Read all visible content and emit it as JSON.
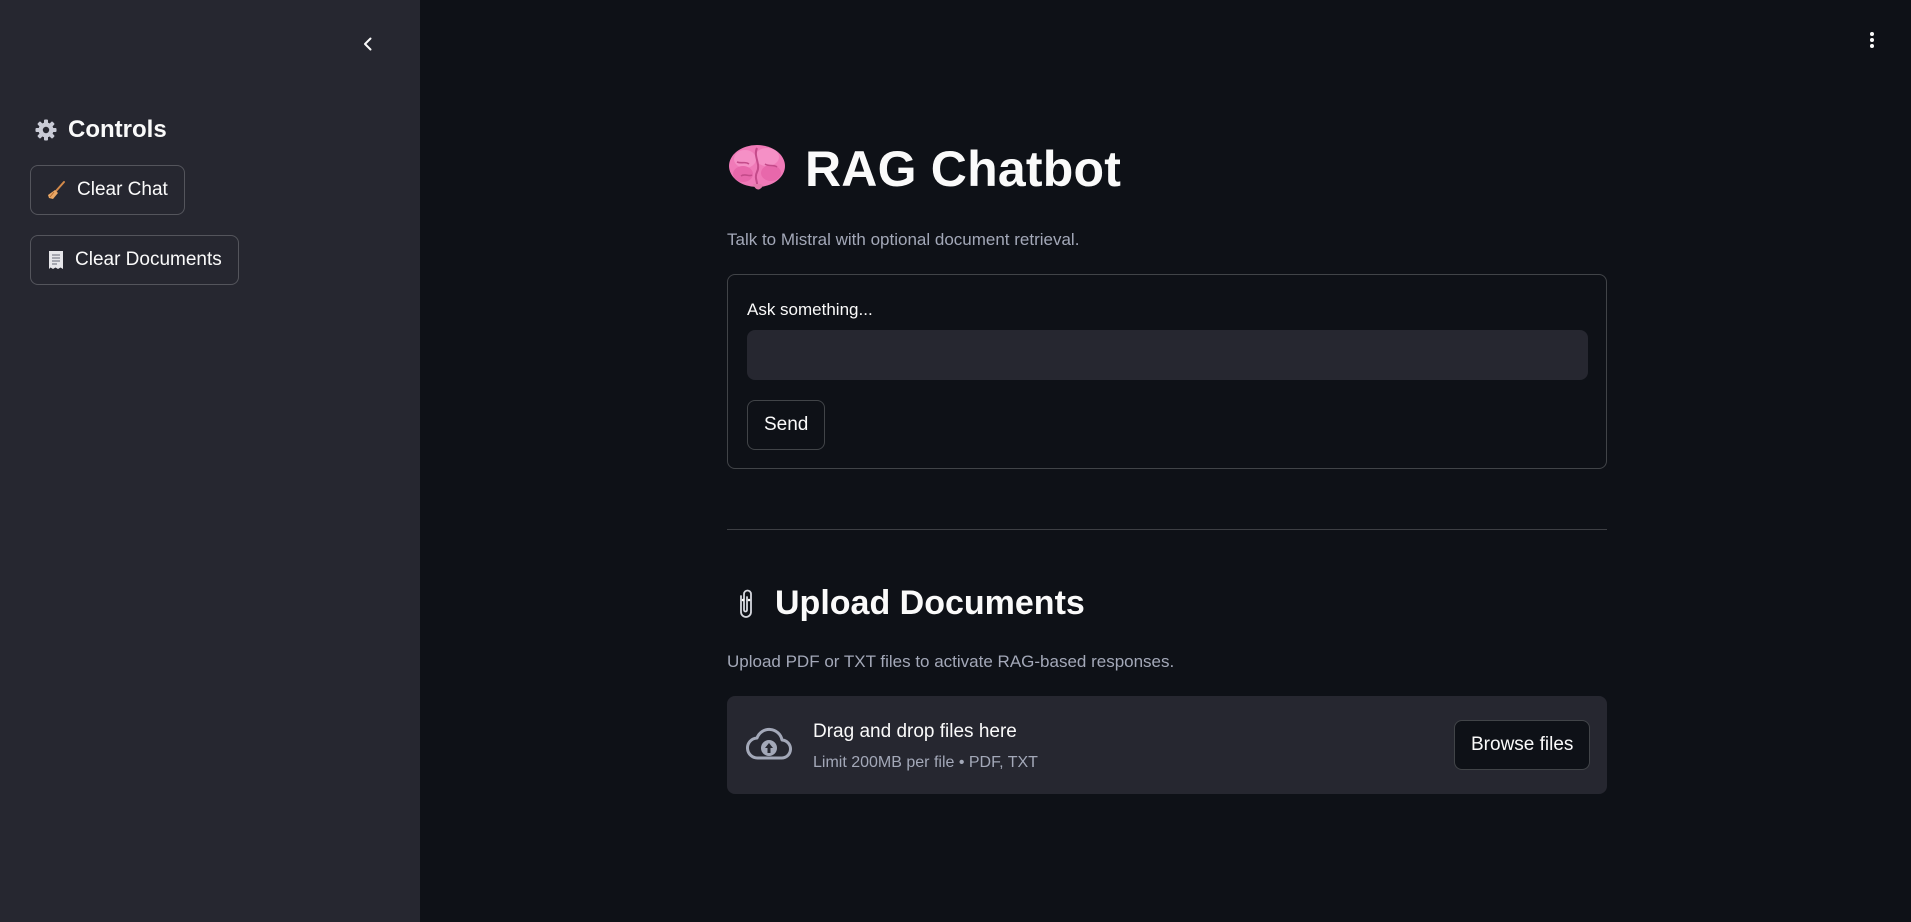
{
  "sidebar": {
    "collapse_icon": "chevron-left-icon",
    "heading": {
      "icon": "gear-icon",
      "label": "Controls"
    },
    "buttons": [
      {
        "icon": "broom-icon",
        "label": "Clear Chat"
      },
      {
        "icon": "receipt-icon",
        "label": "Clear Documents"
      }
    ]
  },
  "header": {
    "menu_icon": "vertical-dots-icon"
  },
  "main": {
    "title_icon": "brain-icon",
    "title": "RAG Chatbot",
    "subtitle": "Talk to Mistral with optional document retrieval.",
    "chat_form": {
      "label": "Ask something...",
      "input_value": "",
      "send_label": "Send"
    },
    "upload": {
      "title_icon": "paperclip-icon",
      "title": "Upload Documents",
      "subtitle": "Upload PDF or TXT files to activate RAG-based responses.",
      "dropzone_icon": "cloud-upload-icon",
      "dropzone_text": "Drag and drop files here",
      "dropzone_limit": "Limit 200MB per file • PDF, TXT",
      "browse_label": "Browse files"
    }
  },
  "colors": {
    "background": "#0e1117",
    "sidebar": "#262730",
    "text": "#fafafa",
    "muted_text": "#a3a8b8",
    "brain_pink": "#f07ab8"
  }
}
